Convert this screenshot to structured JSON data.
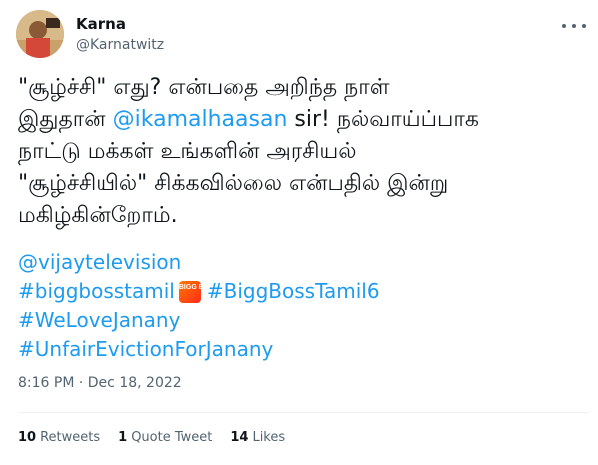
{
  "author": {
    "name": "Karna",
    "handle": "@Karnatwitz"
  },
  "tweet": {
    "line1": "\"சூழ்ச்சி\" எது? என்பதை அறிந்த நாள்",
    "line2_pre": "இதுதான் ",
    "line2_mention": "@ikamalhaasan",
    "line2_post": " sir!  நல்வாய்ப்பாக",
    "line3": "நாட்டு மக்கள் உங்களின் அரசியல்",
    "line4": "\"சூழ்ச்சியில்\" சிக்கவில்லை என்பதில் இன்று",
    "line5": "மகிழ்கின்றோம்.",
    "mention_vijay": "@vijaytelevision",
    "tag1": "#biggbosstamil",
    "tag2": "#BiggBossTamil6",
    "tag3": "#WeLoveJanany",
    "tag4": "#UnfairEvictionForJanany",
    "bb_icon_text": "BIGG BOSS"
  },
  "meta": {
    "time": "8:16 PM",
    "sep": "·",
    "date": "Dec 18, 2022"
  },
  "stats": {
    "retweets_count": "10",
    "retweets_label": "Retweets",
    "quotes_count": "1",
    "quotes_label": "Quote Tweet",
    "likes_count": "14",
    "likes_label": "Likes"
  }
}
